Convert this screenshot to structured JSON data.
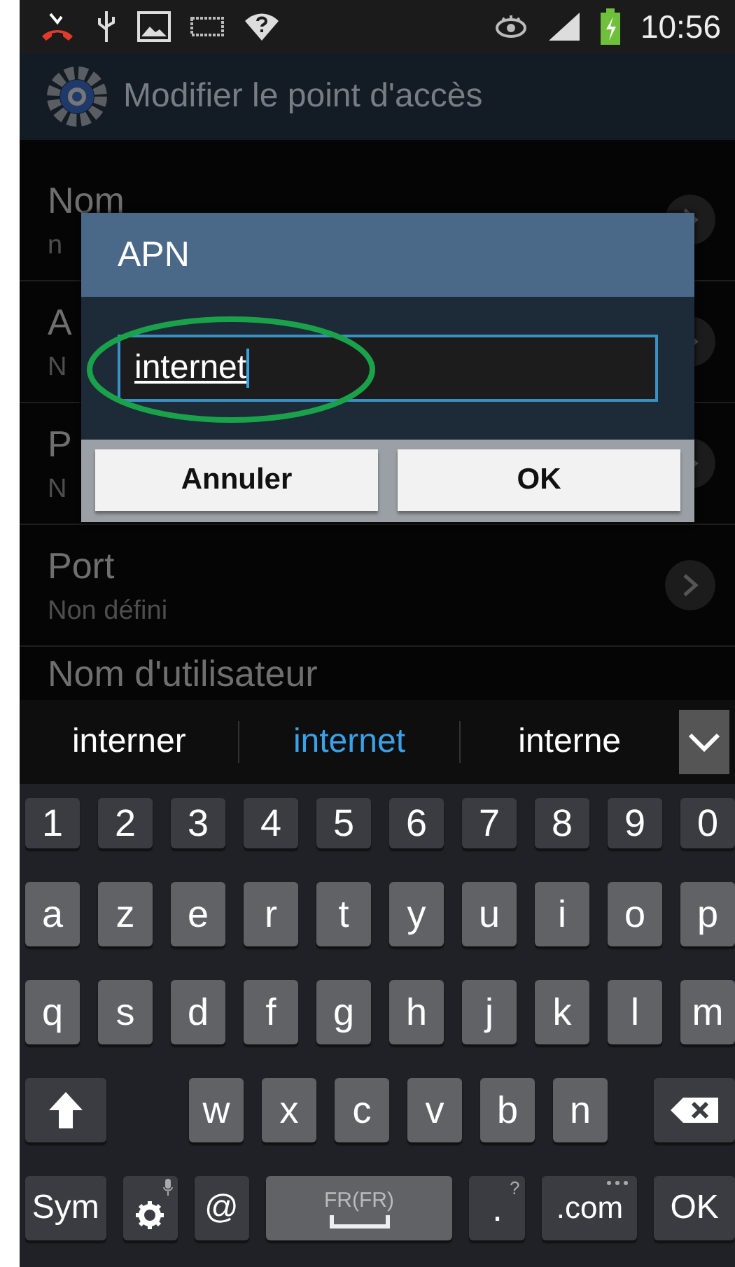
{
  "status_bar": {
    "time": "10:56"
  },
  "action_bar": {
    "title": "Modifier le point d'accès"
  },
  "settings": [
    {
      "title": "Nom",
      "summary": "n"
    },
    {
      "title": "A",
      "summary": "N"
    },
    {
      "title": "P",
      "summary": "N"
    },
    {
      "title": "Port",
      "summary": "Non défini"
    },
    {
      "title": "Nom d'utilisateur"
    }
  ],
  "dialog": {
    "title": "APN",
    "value": "internet",
    "buttons": [
      "Annuler",
      "OK"
    ]
  },
  "suggestions": [
    {
      "label": "interner",
      "selected": false
    },
    {
      "label": "internet",
      "selected": true
    },
    {
      "label": "interne",
      "selected": false
    }
  ],
  "keyboard": {
    "number_row": [
      "1",
      "2",
      "3",
      "4",
      "5",
      "6",
      "7",
      "8",
      "9",
      "0"
    ],
    "letter_rows": [
      [
        "a",
        "z",
        "e",
        "r",
        "t",
        "y",
        "u",
        "i",
        "o",
        "p"
      ],
      [
        "q",
        "s",
        "d",
        "f",
        "g",
        "h",
        "j",
        "k",
        "l",
        "m"
      ],
      [
        "w",
        "x",
        "c",
        "v",
        "b",
        "n"
      ]
    ],
    "bottom_row": [
      {
        "kind": "text",
        "label": "Sym"
      },
      {
        "kind": "settings"
      },
      {
        "kind": "text",
        "label": "@"
      },
      {
        "kind": "space",
        "label": "FR(FR)"
      },
      {
        "kind": "hint",
        "label": ".",
        "hint": "?"
      },
      {
        "kind": "dots",
        "label": ".com"
      },
      {
        "kind": "text",
        "label": "OK"
      }
    ]
  }
}
